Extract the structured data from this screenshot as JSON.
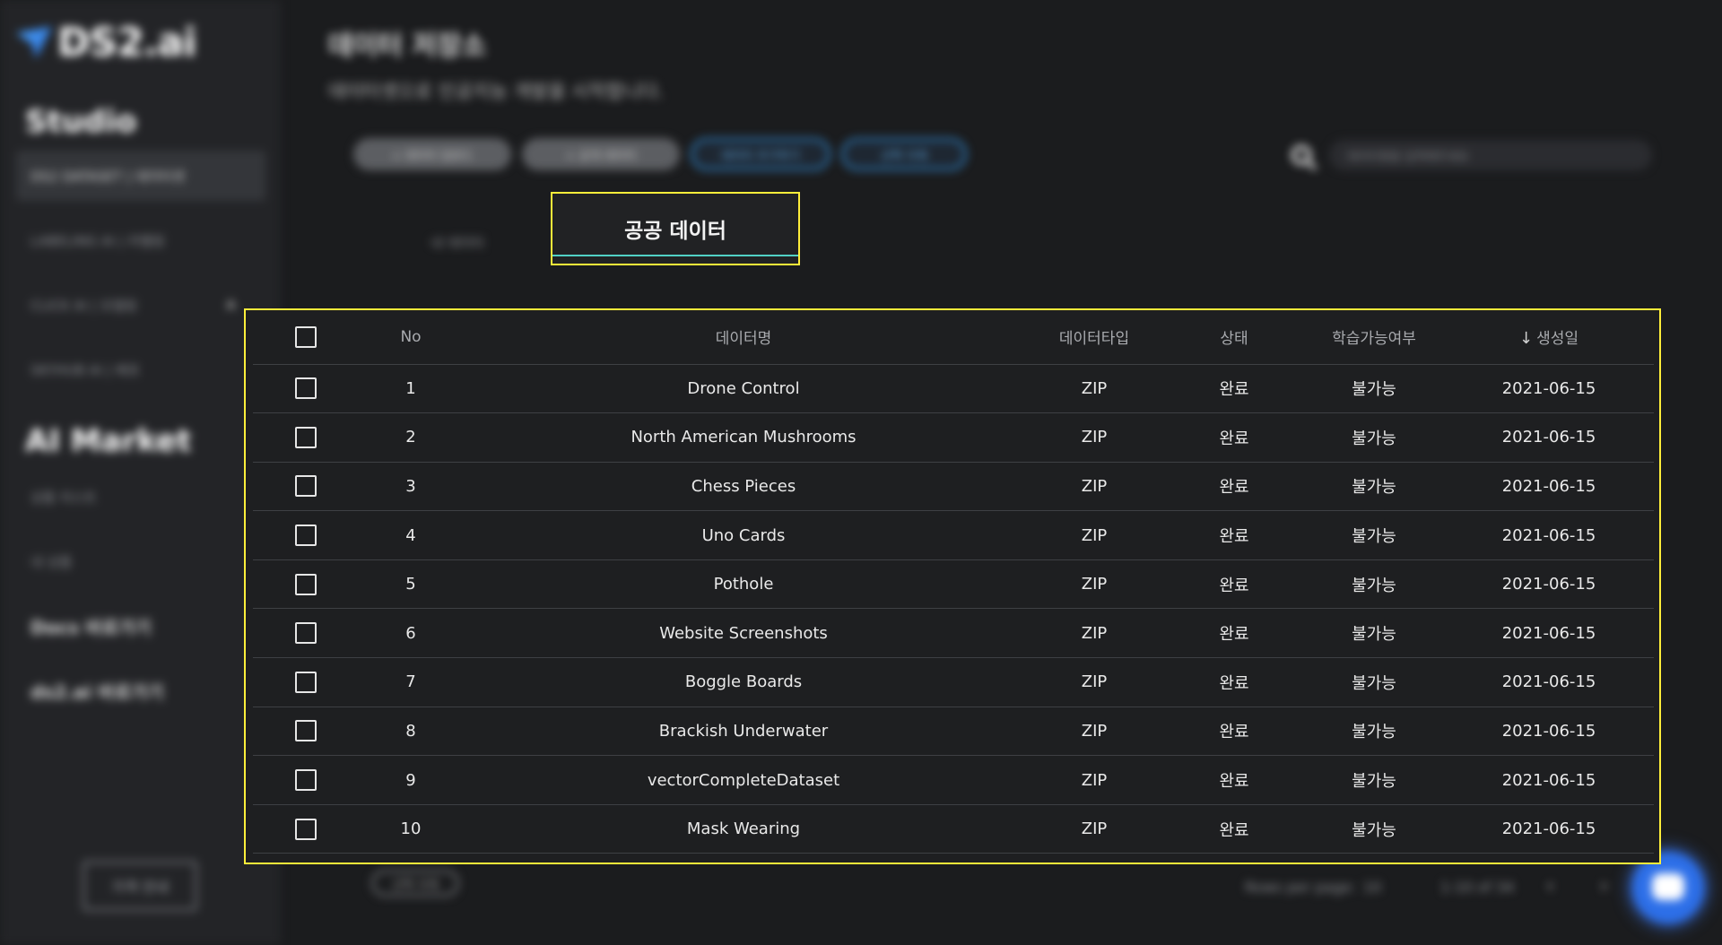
{
  "sidebar": {
    "brand": "DS2.ai",
    "studio_heading": "Studio",
    "studio_items": [
      {
        "label": "DS2 DATASET | 데이터셋"
      },
      {
        "label": "LABELING AI | 라벨링"
      },
      {
        "label": "CLICK AI | 모델링"
      },
      {
        "label": "SKYHUB AI | 배포"
      }
    ],
    "market_heading": "AI Market",
    "market_items": [
      {
        "label": "상품 리스트"
      },
      {
        "label": "내 상품"
      }
    ],
    "links": [
      {
        "label": "Docs 바로가기"
      },
      {
        "label": "ds2.ai 바로가기"
      }
    ],
    "pricing_button": "가격 안내"
  },
  "header": {
    "title": "데이터 저장소",
    "subtitle": "데이터셋으로 인공지능 개발을 시작합니다.",
    "toolbar": [
      {
        "label": "+ 데이터 업로드"
      },
      {
        "label": "+ 공개 데이터"
      },
      {
        "label": "데이터 추가하기"
      },
      {
        "label": "선택 삭제"
      }
    ],
    "search_placeholder": "데이터명을 입력해주세요"
  },
  "tabs": {
    "my_data": "내 데이터",
    "public_data": "공공 데이터"
  },
  "table": {
    "columns": {
      "no": "No",
      "name": "데이터명",
      "type": "데이터타입",
      "status": "상태",
      "trainable": "학습가능여부",
      "created": "생성일"
    },
    "sort_icon": "arrow-down",
    "rows": [
      {
        "no": "1",
        "name": "Drone Control",
        "type": "ZIP",
        "status": "완료",
        "trainable": "불가능",
        "created": "2021-06-15"
      },
      {
        "no": "2",
        "name": "North American Mushrooms",
        "type": "ZIP",
        "status": "완료",
        "trainable": "불가능",
        "created": "2021-06-15"
      },
      {
        "no": "3",
        "name": "Chess Pieces",
        "type": "ZIP",
        "status": "완료",
        "trainable": "불가능",
        "created": "2021-06-15"
      },
      {
        "no": "4",
        "name": "Uno Cards",
        "type": "ZIP",
        "status": "완료",
        "trainable": "불가능",
        "created": "2021-06-15"
      },
      {
        "no": "5",
        "name": "Pothole",
        "type": "ZIP",
        "status": "완료",
        "trainable": "불가능",
        "created": "2021-06-15"
      },
      {
        "no": "6",
        "name": "Website Screenshots",
        "type": "ZIP",
        "status": "완료",
        "trainable": "불가능",
        "created": "2021-06-15"
      },
      {
        "no": "7",
        "name": "Boggle Boards",
        "type": "ZIP",
        "status": "완료",
        "trainable": "불가능",
        "created": "2021-06-15"
      },
      {
        "no": "8",
        "name": "Brackish Underwater",
        "type": "ZIP",
        "status": "완료",
        "trainable": "불가능",
        "created": "2021-06-15"
      },
      {
        "no": "9",
        "name": "vectorCompleteDataset",
        "type": "ZIP",
        "status": "완료",
        "trainable": "불가능",
        "created": "2021-06-15"
      },
      {
        "no": "10",
        "name": "Mask Wearing",
        "type": "ZIP",
        "status": "완료",
        "trainable": "불가능",
        "created": "2021-06-15"
      }
    ]
  },
  "footer": {
    "chip": "선택 삭제",
    "rows_per_page_label": "Rows per page:",
    "rows_per_page_value": "10",
    "range_text": "1-10 of 34"
  },
  "colors": {
    "highlight_border": "#ffee3a",
    "tab_underline": "#51d1c6",
    "accent_blue": "#2f84c8"
  }
}
